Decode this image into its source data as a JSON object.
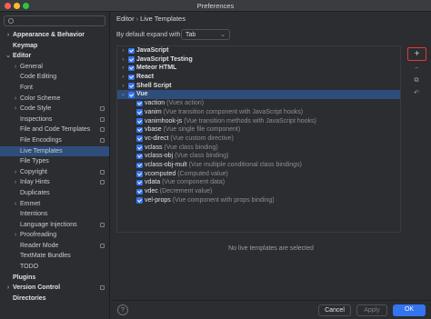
{
  "window": {
    "title": "Preferences"
  },
  "search": {
    "placeholder": ""
  },
  "sidebar": {
    "items": [
      {
        "label": "Appearance & Behavior",
        "chevron": "›",
        "bold": true
      },
      {
        "label": "Keymap",
        "chevron": "",
        "bold": true
      },
      {
        "label": "Editor",
        "chevron": "⌄",
        "bold": true
      },
      {
        "label": "General",
        "chevron": "›",
        "bold": false
      },
      {
        "label": "Code Editing",
        "chevron": "",
        "bold": false
      },
      {
        "label": "Font",
        "chevron": "",
        "bold": false
      },
      {
        "label": "Color Scheme",
        "chevron": "›",
        "bold": false
      },
      {
        "label": "Code Style",
        "chevron": "›",
        "bold": false,
        "gear": true
      },
      {
        "label": "Inspections",
        "chevron": "",
        "bold": false,
        "gear": true
      },
      {
        "label": "File and Code Templates",
        "chevron": "",
        "bold": false,
        "gear": true
      },
      {
        "label": "File Encodings",
        "chevron": "",
        "bold": false,
        "gear": true
      },
      {
        "label": "Live Templates",
        "chevron": "",
        "bold": false,
        "selected": true
      },
      {
        "label": "File Types",
        "chevron": "",
        "bold": false
      },
      {
        "label": "Copyright",
        "chevron": "›",
        "bold": false,
        "gear": true
      },
      {
        "label": "Inlay Hints",
        "chevron": "›",
        "bold": false,
        "gear": true
      },
      {
        "label": "Duplicates",
        "chevron": "",
        "bold": false
      },
      {
        "label": "Emmet",
        "chevron": "›",
        "bold": false
      },
      {
        "label": "Intentions",
        "chevron": "",
        "bold": false
      },
      {
        "label": "Language Injections",
        "chevron": "",
        "bold": false,
        "gear": true
      },
      {
        "label": "Proofreading",
        "chevron": "›",
        "bold": false
      },
      {
        "label": "Reader Mode",
        "chevron": "",
        "bold": false,
        "gear": true
      },
      {
        "label": "TextMate Bundles",
        "chevron": "",
        "bold": false
      },
      {
        "label": "TODO",
        "chevron": "",
        "bold": false
      },
      {
        "label": "Plugins",
        "chevron": "",
        "bold": true
      },
      {
        "label": "Version Control",
        "chevron": "›",
        "bold": true,
        "gear": true
      },
      {
        "label": "Directories",
        "chevron": "",
        "bold": true
      }
    ]
  },
  "header": {
    "crumb1": "Editor",
    "sep": "›",
    "crumb2": "Live Templates"
  },
  "expand": {
    "label": "By default expand with",
    "value": "Tab"
  },
  "templates": {
    "groups": [
      {
        "name": "JavaScript",
        "chevron": "›"
      },
      {
        "name": "JavaScript Testing",
        "chevron": "›"
      },
      {
        "name": "Meteor HTML",
        "chevron": "›"
      },
      {
        "name": "React",
        "chevron": "›"
      },
      {
        "name": "Shell Script",
        "chevron": "›"
      },
      {
        "name": "Vue",
        "chevron": "⌄",
        "selected": true
      }
    ],
    "vue_items": [
      {
        "name": "vaction",
        "desc": "(Vuex action)"
      },
      {
        "name": "vanim",
        "desc": "(Vue transition component with JavaScript hooks)"
      },
      {
        "name": "vanimhook-js",
        "desc": "(Vue transition methods with JavaScript hooks)"
      },
      {
        "name": "vbase",
        "desc": "(Vue single file component)"
      },
      {
        "name": "vc-direct",
        "desc": "(Vue custom directive)"
      },
      {
        "name": "vclass",
        "desc": "(Vue class binding)"
      },
      {
        "name": "vclass-obj",
        "desc": "(Vue class binding)"
      },
      {
        "name": "vclass-obj-mult",
        "desc": "(Vue multiple conditional class bindings)"
      },
      {
        "name": "vcomputed",
        "desc": "(Computed value)"
      },
      {
        "name": "vdata",
        "desc": "(Vue component data)"
      },
      {
        "name": "vdec",
        "desc": "(Decrement value)"
      },
      {
        "name": "vel-props",
        "desc": "(Vue component with props binding)"
      }
    ]
  },
  "toolbar": {
    "add": "+",
    "remove": "−",
    "copy": "⧉",
    "restore": "↶"
  },
  "empty_message": "No live templates are selected",
  "footer": {
    "help": "?",
    "cancel": "Cancel",
    "apply": "Apply",
    "ok": "OK"
  },
  "colors": {
    "accent": "#3574f0",
    "selection": "#2e4d7a",
    "highlight_border": "#e53935"
  }
}
